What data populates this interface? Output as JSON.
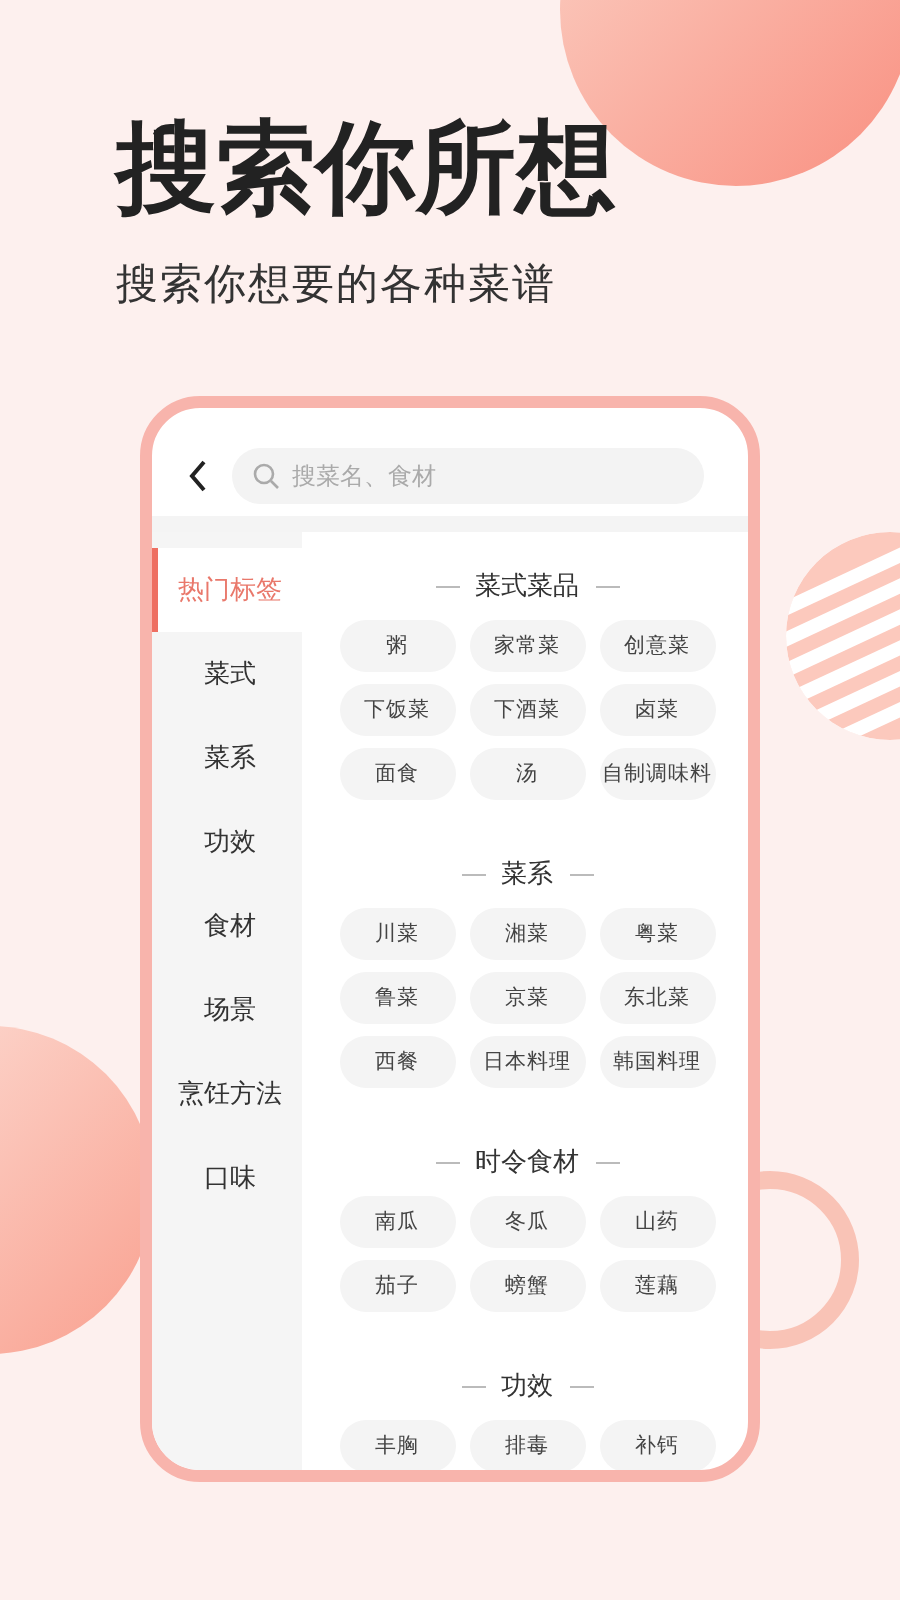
{
  "headline": "搜索你所想",
  "subtitle": "搜索你想要的各种菜谱",
  "search": {
    "placeholder": "搜菜名、食材"
  },
  "sidebar": {
    "items": [
      {
        "label": "热门标签",
        "selected": true
      },
      {
        "label": "菜式",
        "selected": false
      },
      {
        "label": "菜系",
        "selected": false
      },
      {
        "label": "功效",
        "selected": false
      },
      {
        "label": "食材",
        "selected": false
      },
      {
        "label": "场景",
        "selected": false
      },
      {
        "label": "烹饪方法",
        "selected": false
      },
      {
        "label": "口味",
        "selected": false
      }
    ]
  },
  "sections": [
    {
      "title": "菜式菜品",
      "tags": [
        "粥",
        "家常菜",
        "创意菜",
        "下饭菜",
        "下酒菜",
        "卤菜",
        "面食",
        "汤",
        "自制调味料"
      ]
    },
    {
      "title": "菜系",
      "tags": [
        "川菜",
        "湘菜",
        "粤菜",
        "鲁菜",
        "京菜",
        "东北菜",
        "西餐",
        "日本料理",
        "韩国料理"
      ]
    },
    {
      "title": "时令食材",
      "tags": [
        "南瓜",
        "冬瓜",
        "山药",
        "茄子",
        "螃蟹",
        "莲藕"
      ]
    },
    {
      "title": "功效",
      "tags": [
        "丰胸",
        "排毒",
        "补钙"
      ]
    }
  ]
}
